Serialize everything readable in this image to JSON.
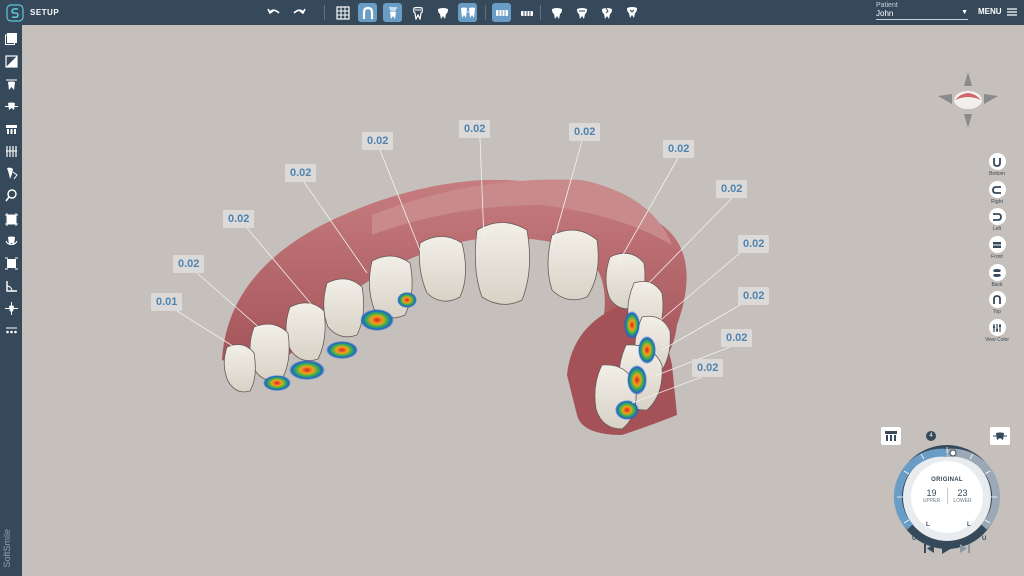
{
  "app": {
    "title": "SETUP"
  },
  "toolbar": {
    "history": [
      "undo-icon",
      "redo-icon"
    ],
    "view_tools": [
      {
        "icon": "grid-icon",
        "active": false
      },
      {
        "icon": "arch-icon",
        "active": true
      },
      {
        "icon": "tooth-attachment-icon",
        "active": true
      },
      {
        "icon": "tooth-root-icon",
        "active": false
      },
      {
        "icon": "tooth-icon",
        "active": false
      },
      {
        "icon": "teeth-contact-icon",
        "active": true
      }
    ],
    "arch_tools": [
      {
        "icon": "upper-arch-icon",
        "active": true
      },
      {
        "icon": "lower-arch-icon",
        "active": false
      }
    ],
    "tooth_tools": [
      "tooth-single-icon",
      "tooth-double-icon",
      "tooth-broken-icon",
      "tooth-arrow-icon"
    ]
  },
  "patient": {
    "label": "Patient",
    "name": "John"
  },
  "menu": {
    "label": "MENU"
  },
  "sidebar": {
    "items": [
      "gallery-icon",
      "compare-icon",
      "tooth-move-icon",
      "ipr-icon",
      "attachments-icon",
      "measure-icon",
      "bite-icon",
      "search-tooth-icon",
      "crop-icon",
      "rotate-tooth-icon",
      "select-tooth-icon",
      "angle-icon",
      "move-axis-icon",
      "more-dots-icon"
    ],
    "brand": "SoftSmile"
  },
  "distance_labels": [
    "0.01",
    "0.02",
    "0.02",
    "0.02",
    "0.02",
    "0.02",
    "0.02",
    "0.02",
    "0.02",
    "0.02",
    "0.02",
    "0.02",
    "0.02"
  ],
  "view_controls": [
    {
      "label": "Bottom",
      "icon": "view-bottom-icon"
    },
    {
      "label": "Right",
      "icon": "view-right-icon"
    },
    {
      "label": "Left",
      "icon": "view-left-icon"
    },
    {
      "label": "Front",
      "icon": "view-front-icon"
    },
    {
      "label": "Back",
      "icon": "view-back-icon"
    },
    {
      "label": "Top",
      "icon": "view-top-icon"
    },
    {
      "label": "View Color",
      "icon": "view-color-icon"
    }
  ],
  "step_dial": {
    "title": "ORIGINAL",
    "upper_count": "19",
    "upper_label": "UPPER",
    "lower_count": "23",
    "lower_label": "LOWER",
    "badge": "4",
    "marker_u": "U",
    "marker_l": "L"
  },
  "colors": {
    "primary": "#35495a",
    "accent": "#6a9dc6",
    "label_text": "#4f83b0",
    "background": "#c5c0bc"
  }
}
